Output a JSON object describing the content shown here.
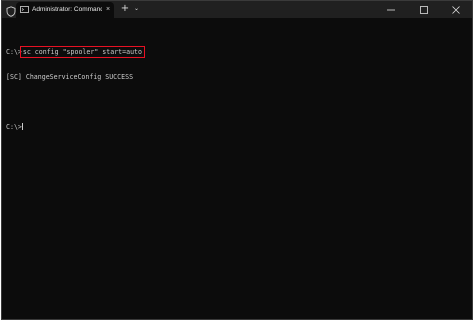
{
  "window": {
    "tab_title": "Administrator: Command Prom",
    "tab_close_glyph": "×",
    "new_tab_glyph": "+",
    "dropdown_glyph": "⌄",
    "icons": [
      "shield-icon",
      "terminal-icon",
      "close-icon",
      "plus-icon",
      "chevron-down-icon",
      "minimize-icon",
      "maximize-icon",
      "close-window-icon"
    ]
  },
  "terminal": {
    "prompt1": "C:\\>",
    "command": "sc config \"spooler\" start=auto",
    "output": "[SC] ChangeServiceConfig SUCCESS",
    "prompt2": "C:\\>",
    "highlight_color": "#e81123"
  }
}
